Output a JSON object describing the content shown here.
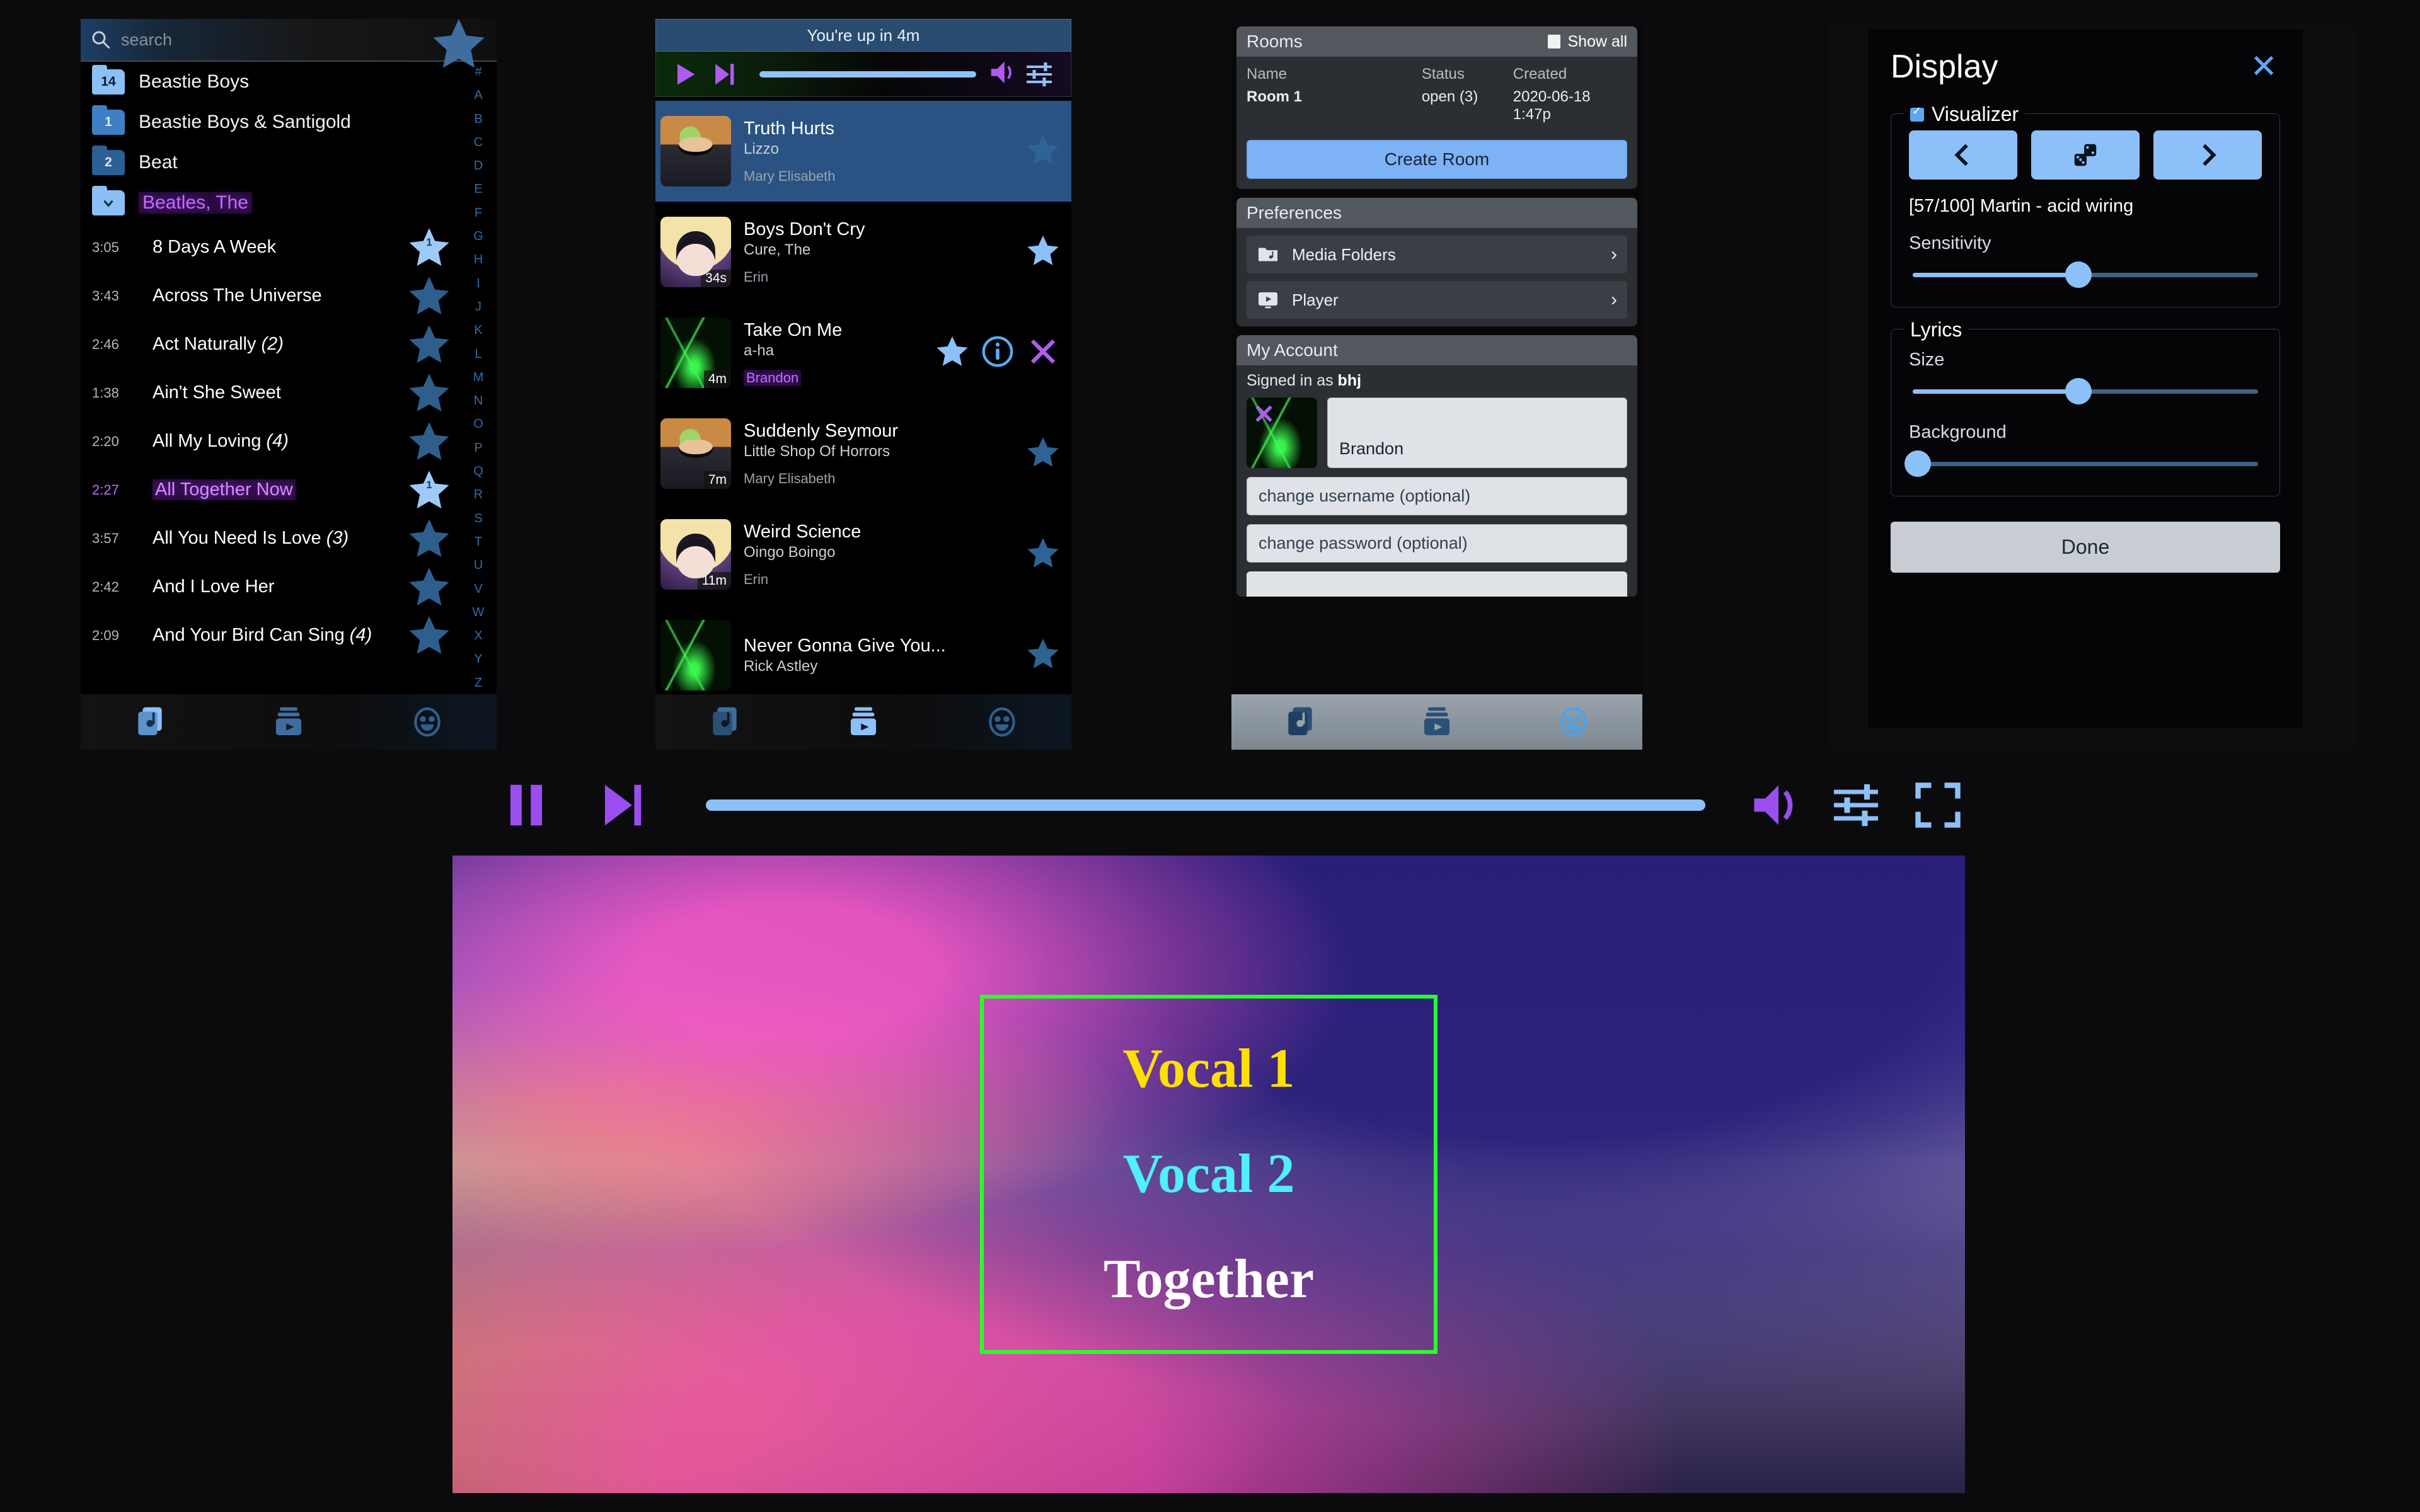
{
  "library": {
    "search": {
      "placeholder": "search",
      "value": ""
    },
    "favorite_icon": "star-icon",
    "groups": [
      {
        "count": "14",
        "name": "Beastie Boys",
        "tone": "light",
        "selected": false
      },
      {
        "count": "1",
        "name": "Beastie Boys & Santigold",
        "tone": "mid",
        "selected": false
      },
      {
        "count": "2",
        "name": "Beat",
        "tone": "dark",
        "selected": false
      },
      {
        "count": "",
        "name": "Beatles, The",
        "tone": "light",
        "selected": true
      }
    ],
    "songs": [
      {
        "time": "3:05",
        "title": "8 Days A Week",
        "alt": "",
        "star": "filled",
        "star_count": "1",
        "selected": false
      },
      {
        "time": "3:43",
        "title": "Across The Universe",
        "alt": "",
        "star": "dim",
        "star_count": "",
        "selected": false
      },
      {
        "time": "2:46",
        "title": "Act Naturally ",
        "alt": "(2)",
        "star": "dim",
        "star_count": "",
        "selected": false
      },
      {
        "time": "1:38",
        "title": "Ain't She Sweet",
        "alt": "",
        "star": "dim",
        "star_count": "",
        "selected": false
      },
      {
        "time": "2:20",
        "title": "All My Loving ",
        "alt": "(4)",
        "star": "dim",
        "star_count": "",
        "selected": false
      },
      {
        "time": "2:27",
        "title": "All Together Now",
        "alt": "",
        "star": "filled",
        "star_count": "1",
        "selected": true
      },
      {
        "time": "3:57",
        "title": "All You Need Is Love ",
        "alt": "(3)",
        "star": "dim",
        "star_count": "",
        "selected": false
      },
      {
        "time": "2:42",
        "title": "And I Love Her",
        "alt": "",
        "star": "dim",
        "star_count": "",
        "selected": false
      },
      {
        "time": "2:09",
        "title": "And Your Bird Can Sing ",
        "alt": "(4)",
        "star": "dim",
        "star_count": "",
        "selected": false
      }
    ],
    "alpha_index": [
      "#",
      "A",
      "B",
      "C",
      "D",
      "E",
      "F",
      "G",
      "H",
      "I",
      "J",
      "K",
      "L",
      "M",
      "N",
      "O",
      "P",
      "Q",
      "R",
      "S",
      "T",
      "U",
      "V",
      "W",
      "X",
      "Y",
      "Z"
    ],
    "tabs": [
      {
        "icon": "music-library-icon",
        "active": true
      },
      {
        "icon": "queue-play-icon",
        "active": false
      },
      {
        "icon": "smiley-face-icon",
        "active": false
      }
    ]
  },
  "queue": {
    "banner": "You're up in 4m",
    "mini_player": {
      "play_icon": "play-icon",
      "next_icon": "skip-next-icon",
      "volume_icon": "volume-icon",
      "equalizer_icon": "equalizer-icon",
      "seek_percent": 100
    },
    "items": [
      {
        "title": "Truth Hurts",
        "artist": "Lizzo",
        "user": "Mary Elisabeth",
        "eta": "",
        "thumb": "mary",
        "current": true,
        "star": "dim",
        "user_highlight": false,
        "show_info": false,
        "show_remove": false
      },
      {
        "title": "Boys Don't Cry",
        "artist": "Cure, The",
        "user": "Erin",
        "eta": "34s",
        "thumb": "erin",
        "current": false,
        "star": "bright",
        "user_highlight": false,
        "show_info": false,
        "show_remove": false
      },
      {
        "title": "Take On Me",
        "artist": "a-ha",
        "user": "Brandon",
        "eta": "4m",
        "thumb": "laser",
        "current": false,
        "star": "bright",
        "user_highlight": true,
        "show_info": true,
        "show_remove": true
      },
      {
        "title": "Suddenly Seymour",
        "artist": "Little Shop Of Horrors",
        "user": "Mary Elisabeth",
        "eta": "7m",
        "thumb": "mary",
        "current": false,
        "star": "dim",
        "user_highlight": false,
        "show_info": false,
        "show_remove": false
      },
      {
        "title": "Weird Science",
        "artist": "Oingo Boingo",
        "user": "Erin",
        "eta": "11m",
        "thumb": "erin",
        "current": false,
        "star": "dim",
        "user_highlight": false,
        "show_info": false,
        "show_remove": false
      },
      {
        "title": "Never Gonna Give You...",
        "artist": "Rick Astley",
        "user": "",
        "eta": "",
        "thumb": "laser",
        "current": false,
        "star": "dim",
        "user_highlight": false,
        "show_info": false,
        "show_remove": false
      }
    ],
    "tabs": [
      {
        "icon": "music-library-icon",
        "active": false
      },
      {
        "icon": "queue-play-icon",
        "active": true
      },
      {
        "icon": "smiley-face-icon",
        "active": false
      }
    ]
  },
  "rooms": {
    "title": "Rooms",
    "show_all_label": "Show all",
    "columns": [
      "Name",
      "Status",
      "Created"
    ],
    "rows": [
      {
        "name": "Room 1",
        "status": "open (3)",
        "created": "2020-06-18 1:47p"
      }
    ],
    "create_button": "Create Room"
  },
  "preferences": {
    "title": "Preferences",
    "items": [
      {
        "label": "Media Folders",
        "icon": "folder-music-icon",
        "chevron": "›"
      },
      {
        "label": "Player",
        "icon": "player-screen-icon",
        "chevron": "›"
      }
    ]
  },
  "account": {
    "title": "My Account",
    "signed_in_prefix": "Signed in as ",
    "username": "bhj",
    "avatar_remove_icon": "close-x-icon",
    "display_name_value": "Brandon",
    "change_username_placeholder": "change username (optional)",
    "change_password_placeholder": "change password (optional)",
    "tabs": [
      {
        "icon": "music-library-icon",
        "active": false
      },
      {
        "icon": "queue-play-icon",
        "active": false
      },
      {
        "icon": "smiley-face-icon",
        "active": true
      }
    ]
  },
  "display_dialog": {
    "title": "Display",
    "close_icon": "close-x-icon",
    "visualizer": {
      "legend": "Visualizer",
      "enabled": true,
      "prev_icon": "chevron-left-icon",
      "random_icon": "dice-icon",
      "next_icon": "chevron-right-icon",
      "preset_name": "[57/100] Martin - acid wiring",
      "sensitivity_label": "Sensitivity",
      "sensitivity_percent": 48
    },
    "lyrics": {
      "legend": "Lyrics",
      "size_label": "Size",
      "size_percent": 48,
      "background_label": "Background",
      "background_percent": 0
    },
    "done_button": "Done"
  },
  "player_bar": {
    "pause_icon": "pause-icon",
    "next_icon": "skip-next-icon",
    "seek_percent": 100,
    "volume_icon": "volume-icon",
    "equalizer_icon": "equalizer-icon",
    "fullscreen_icon": "fullscreen-icon"
  },
  "video_stage": {
    "lyrics_lines": [
      {
        "text": "Vocal 1",
        "color": "#ffe000"
      },
      {
        "text": "Vocal 2",
        "color": "#4ff0f7"
      },
      {
        "text": "Together",
        "color": "#ffffff"
      }
    ],
    "frame_color": "#2bff2b"
  },
  "colors": {
    "accent_blue": "#8cc0f8",
    "accent_purple": "#b05bf0",
    "selected_row": "#2a5384",
    "banner_blue": "#2a4b70",
    "green_frame": "#2bff2b"
  }
}
